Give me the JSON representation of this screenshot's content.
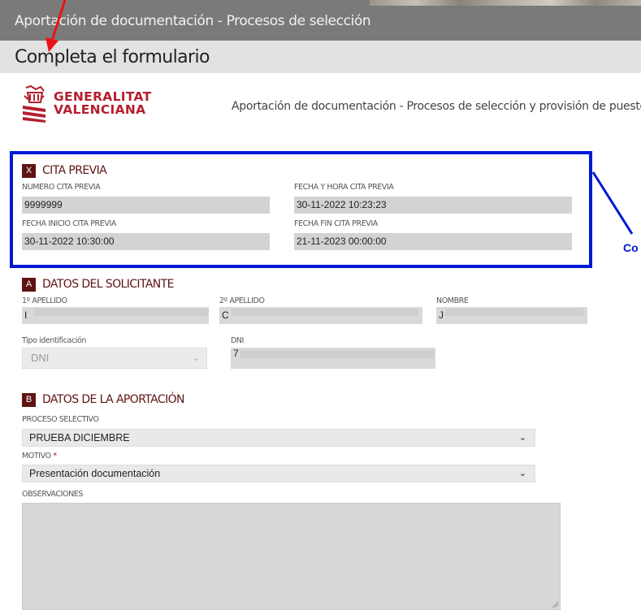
{
  "header": {
    "title": "Aportación de documentación - Procesos de selección",
    "subtitle": "Completa el formulario"
  },
  "brand": {
    "logo_line1": "GENERALITAT",
    "logo_line2": "VALENCIANA",
    "description": "Aportación de documentación - Procesos de selección y provisión de puestos"
  },
  "cita_previa": {
    "badge": "X",
    "title": "CITA PREVIA",
    "numero_label": "NUMERO CITA PREVIA",
    "numero_value": "9999999",
    "fecha_hora_label": "FECHA Y HORA CITA PREVIA",
    "fecha_hora_value": "30-11-2022 10:23:23",
    "inicio_label": "FECHA INICIO CITA PREVIA",
    "inicio_value": "30-11-2022 10:30:00",
    "fin_label": "FECHA FIN CITA PREVIA",
    "fin_value": "21-11-2023 00:00:00"
  },
  "solicitante": {
    "badge": "A",
    "title": "DATOS DEL SOLICITANTE",
    "apellido1_label": "1º APELLIDO",
    "apellido1_value": "I",
    "apellido2_label": "2º APELLIDO",
    "apellido2_value": "C",
    "nombre_label": "NOMBRE",
    "nombre_value": "J",
    "tipo_id_label": "Tipo identificación",
    "tipo_id_value": "DNI",
    "dni_label": "DNI",
    "dni_value": "7"
  },
  "aportacion": {
    "badge": "B",
    "title": "DATOS DE LA APORTACIÓN",
    "proceso_label": "PROCESO SELECTIVO",
    "proceso_value": "PRUEBA DICIEMBRE",
    "motivo_label": "MOTIVO",
    "motivo_required": "*",
    "motivo_value": "Presentación documentación",
    "observaciones_label": "OBSERVACIONES"
  },
  "annotation": {
    "text": "Co",
    "color": "#0019d6",
    "arrow_color": "#e81414"
  },
  "colors": {
    "section_accent": "#5e1414",
    "brand_red": "#b41f2e",
    "topbar": "#7a7a7a"
  }
}
